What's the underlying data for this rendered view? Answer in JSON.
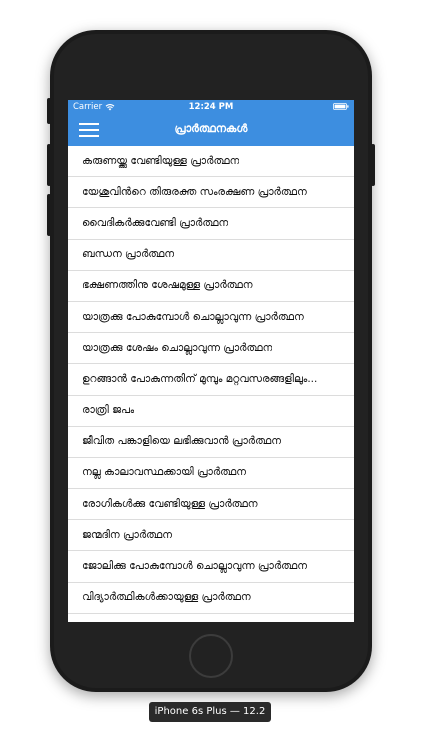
{
  "statusbar": {
    "carrier": "Carrier",
    "time": "12:24 PM"
  },
  "navbar": {
    "title": "പ്രാർത്ഥനകൾ"
  },
  "list": {
    "items": [
      "കരുണയ്ക്കു വേണ്ടിയുള്ള പ്രാർത്ഥന",
      "യേശുവിൻറെ തിരുരക്ത സംരക്ഷണ പ്രാർത്ഥന",
      "വൈദികർക്കുവേണ്ടി പ്രാർത്ഥന",
      "ബന്ധന പ്രാർത്ഥന",
      "ഭക്ഷണത്തിനു ശേഷമുള്ള പ്രാർത്ഥന",
      "യാത്രക്കു പോകുമ്പോൾ ചൊല്ലാവുന്ന പ്രാർത്ഥന",
      "യാത്രക്കു ശേഷം ചൊല്ലാവുന്ന പ്രാർത്ഥന",
      "ഉറങ്ങാൻ പോകുന്നതിന് മുമ്പും മറ്റവസരങ്ങളിലും...",
      "രാത്രി ജപം",
      "ജീവിത പങ്കാളിയെ ലഭിക്കുവാൻ പ്രാർത്ഥന",
      "നല്ല കാലാവസ്ഥക്കായി പ്രാർത്ഥന",
      "രോഗികൾക്കു വേണ്ടിയുള്ള പ്രാർത്ഥന",
      "ജന്മദിന പ്രാർത്ഥന",
      "ജോലിക്കു പോകുമ്പോൾ ചൊല്ലാവുന്ന പ്രാർത്ഥന",
      "വിദ്യാർത്ഥികൾക്കായുള്ള പ്രാർത്ഥന"
    ]
  },
  "simulator": {
    "device_label": "iPhone 6s Plus — 12.2"
  },
  "icons": {
    "menu": "hamburger-menu-icon",
    "wifi": "wifi-icon",
    "battery": "battery-icon"
  },
  "colors": {
    "accent": "#3d8ee0",
    "device_frame": "#1b1b1b",
    "separator": "#dcdcdc"
  }
}
